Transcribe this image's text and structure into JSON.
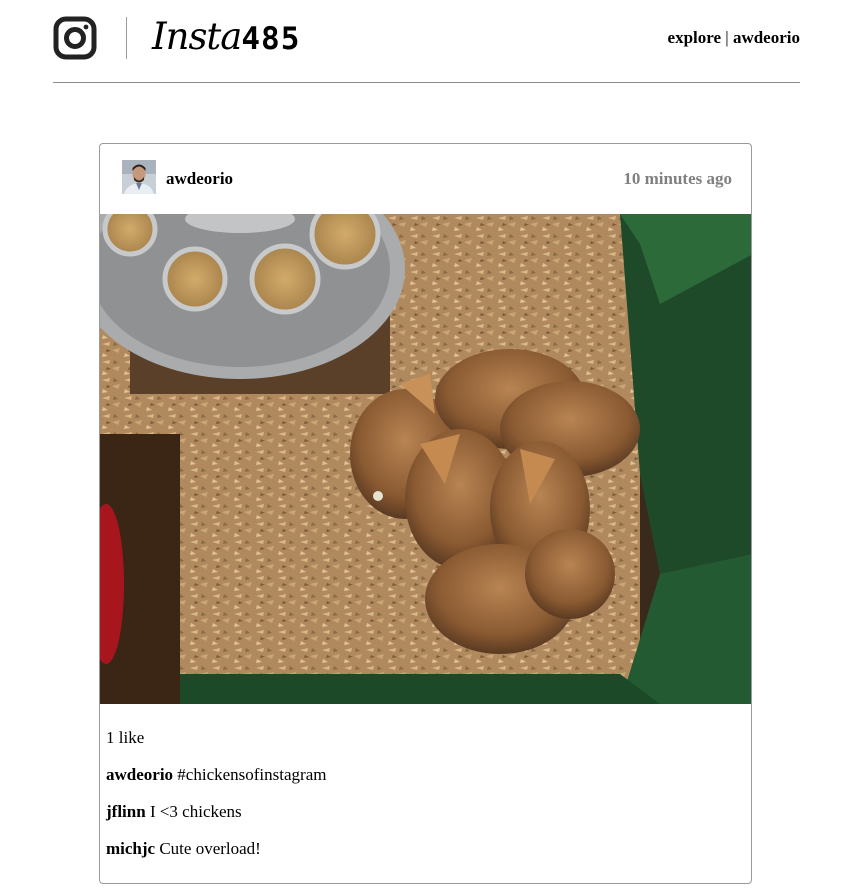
{
  "header": {
    "logo_script": "Insta",
    "logo_number": "485",
    "nav_explore": "explore",
    "nav_separator": "|",
    "nav_user": "awdeorio"
  },
  "post": {
    "owner": "awdeorio",
    "timestamp": "10 minutes ago",
    "likes_text": "1 like",
    "comments": [
      {
        "owner": "awdeorio",
        "text": "#chickensofinstagram"
      },
      {
        "owner": "jflinn",
        "text": "I <3 chickens"
      },
      {
        "owner": "michjc",
        "text": "Cute overload!"
      }
    ]
  },
  "icons": {
    "logo": "instagram-camera-icon"
  }
}
